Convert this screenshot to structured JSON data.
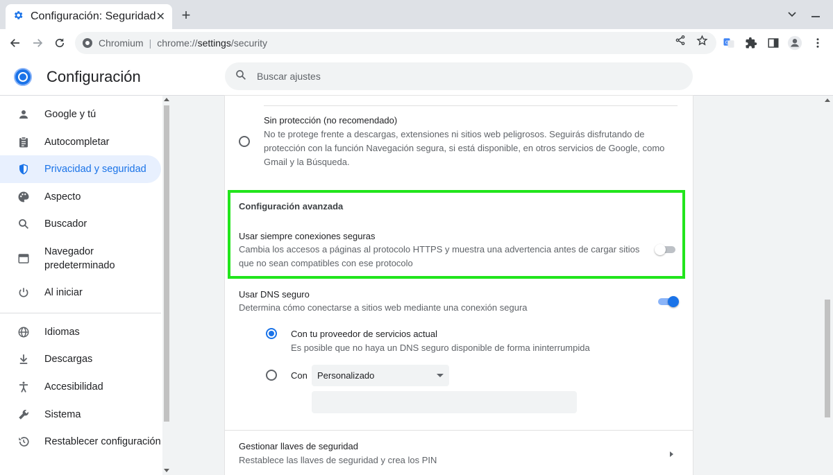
{
  "browser": {
    "tab_title": "Configuración: Seguridad",
    "tab_close": "✕",
    "new_tab": "+",
    "omnibox": {
      "site_name": "Chromium",
      "separator": "|",
      "url_prefix": "chrome://",
      "url_host": "settings",
      "url_suffix": "/security"
    }
  },
  "header": {
    "title": "Configuración",
    "search_placeholder": "Buscar ajustes"
  },
  "sidebar": {
    "items": [
      {
        "label": "Google y tú",
        "icon": "person-icon"
      },
      {
        "label": "Autocompletar",
        "icon": "clipboard-icon"
      },
      {
        "label": "Privacidad y seguridad",
        "icon": "shield-icon",
        "active": true
      },
      {
        "label": "Aspecto",
        "icon": "palette-icon"
      },
      {
        "label": "Buscador",
        "icon": "search-icon"
      },
      {
        "label": "Navegador predeterminado",
        "icon": "browser-window-icon"
      },
      {
        "label": "Al iniciar",
        "icon": "power-icon"
      },
      {
        "label": "Idiomas",
        "icon": "globe-icon"
      },
      {
        "label": "Descargas",
        "icon": "download-icon"
      },
      {
        "label": "Accesibilidad",
        "icon": "accessibility-icon"
      },
      {
        "label": "Sistema",
        "icon": "wrench-icon"
      },
      {
        "label": "Restablecer configuración",
        "icon": "restore-icon"
      }
    ]
  },
  "main": {
    "no_protection": {
      "title": "Sin protección (no recomendado)",
      "desc_line1": "No te protege frente a descargas, extensiones ni sitios web peligrosos. Seguirás disfrutando de",
      "desc_line2": "protección con la función Navegación segura, si está disponible, en otros servicios de Google, como",
      "desc_line3": "Gmail y la Búsqueda.",
      "selected": false
    },
    "advanced": {
      "section_title": "Configuración avanzada",
      "https_title": "Usar siempre conexiones seguras",
      "https_desc_line1": "Cambia los accesos a páginas al protocolo HTTPS y muestra una advertencia antes de cargar sitios",
      "https_desc_line2": "que no sean compatibles con ese protocolo",
      "https_enabled": false
    },
    "dns": {
      "title": "Usar DNS seguro",
      "desc": "Determina cómo conectarse a sitios web mediante una conexión segura",
      "enabled": true,
      "option_current_title": "Con tu proveedor de servicios actual",
      "option_current_desc": "Es posible que no haya un DNS seguro disponible de forma ininterrumpida",
      "option_current_selected": true,
      "option_custom_label": "Con",
      "option_custom_selected": false,
      "custom_select_value": "Personalizado",
      "custom_input_value": ""
    },
    "security_keys": {
      "title": "Gestionar llaves de seguridad",
      "desc": "Restablece las llaves de seguridad y crea los PIN"
    }
  },
  "colors": {
    "accent": "#1a73e8",
    "highlight_border": "#22e51c",
    "active_nav_bg": "#e8f0fe"
  }
}
